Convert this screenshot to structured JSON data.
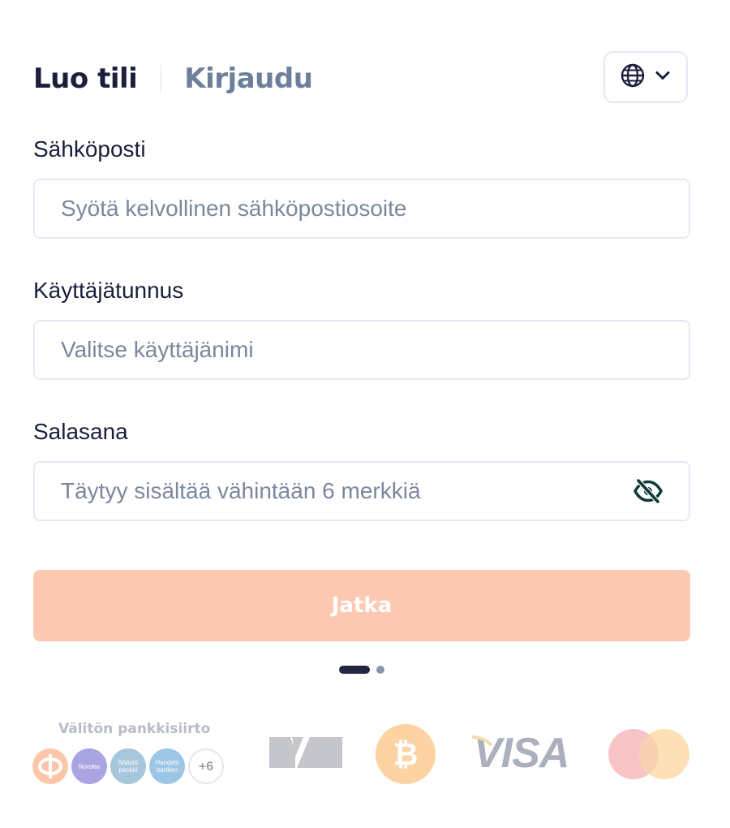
{
  "tabs": {
    "register": "Luo tili",
    "login": "Kirjaudu"
  },
  "language_button": {
    "icon": "globe-icon",
    "chevron": "chevron-down-icon"
  },
  "form": {
    "email": {
      "label": "Sähköposti",
      "placeholder": "Syötä kelvollinen sähköpostiosoite",
      "value": ""
    },
    "username": {
      "label": "Käyttäjätunnus",
      "placeholder": "Valitse käyttäjänimi",
      "value": ""
    },
    "password": {
      "label": "Salasana",
      "placeholder": "Täytyy sisältää vähintään 6 merkkiä",
      "value": "",
      "toggle_icon": "eye-off-icon"
    },
    "submit_label": "Jatka"
  },
  "pagination": {
    "current_step": 1,
    "total_steps": 2
  },
  "payments": {
    "bank_title": "Välitön pankkisiirto",
    "banks": [
      "OP",
      "Nordea",
      "Säästöpankki",
      "Handelsbanken"
    ],
    "more_banks": "+6",
    "methods": [
      "Muchbetter",
      "Bitcoin",
      "VISA",
      "Mastercard"
    ],
    "visa_text": "VISA"
  },
  "colors": {
    "primary_text": "#1b1f3b",
    "muted_tab": "#6e7f9a",
    "button_disabled": "#fdc9b2",
    "placeholder": "#7b879c",
    "eye_icon": "#0f3b3a"
  }
}
